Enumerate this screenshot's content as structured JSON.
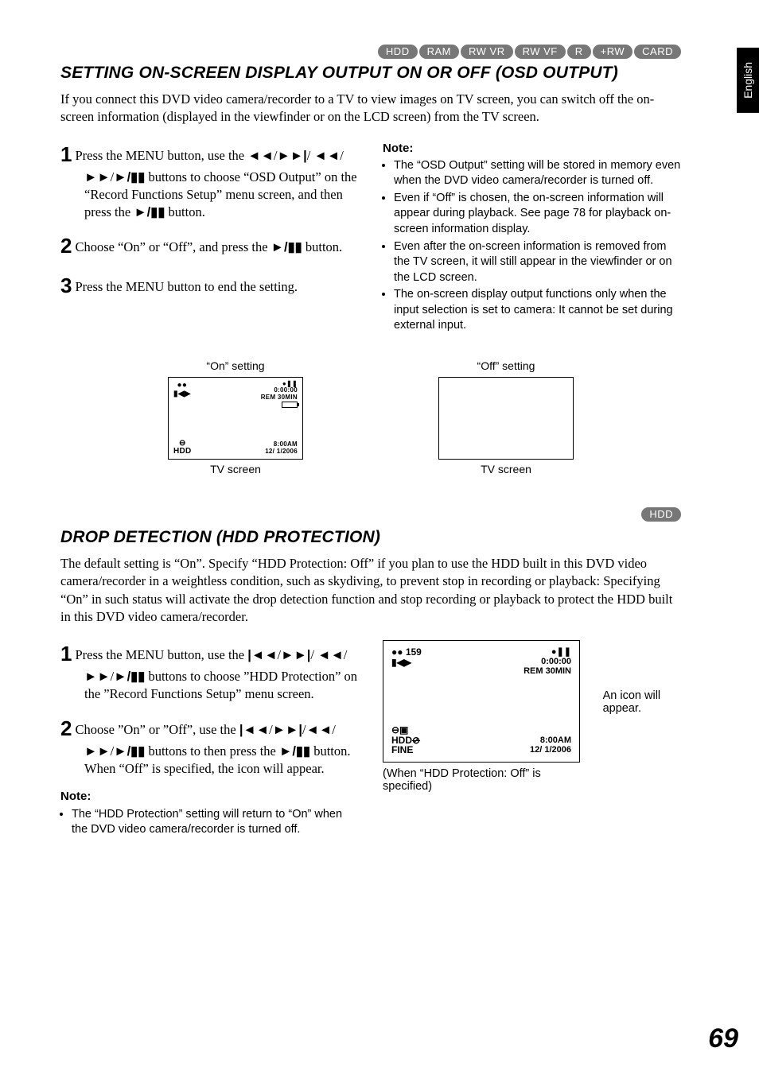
{
  "sideTab": "English",
  "pageNumber": "69",
  "tags1": [
    "HDD",
    "RAM",
    "RW VR",
    "RW VF",
    "R",
    "+RW",
    "CARD"
  ],
  "section1": {
    "title": "SETTING ON-SCREEN DISPLAY OUTPUT ON OR OFF (OSD OUTPUT)",
    "intro": "If you connect this DVD video camera/recorder to a TV to view images on TV screen, you can switch off the on-screen information (displayed in the viewfinder or on the LCD screen) from the TV screen.",
    "step1a": "Press the MENU button, use the ",
    "step1b": " buttons to choose “OSD Output” on the “Record Functions Setup” menu screen, and then press the ",
    "step1c": " button.",
    "step2a": "Choose “On” or “Off”, and press the ",
    "step2b": " button.",
    "step3": "Press the MENU button to end the setting.",
    "noteHead": "Note:",
    "notes": [
      "The “OSD Output” setting will be stored in memory even when the DVD video camera/recorder is turned off.",
      "Even if “Off” is chosen, the on-screen information will appear during playback. See page 78 for playback on-screen information display.",
      "Even after the on-screen information is removed from the TV screen, it will still appear in the viewfinder or on the LCD screen.",
      "The on-screen display output functions only when the input selection is set to camera: It cannot be set during external input."
    ],
    "tvOn": {
      "caption": "“On” setting",
      "below": "TV screen",
      "timecode": "0:00:00",
      "rem": "REM 30MIN",
      "time": "8:00AM",
      "date": "12/ 1/2006",
      "pause": "●❚❚"
    },
    "tvOff": {
      "caption": "“Off” setting",
      "below": "TV screen"
    }
  },
  "tags2": [
    "HDD"
  ],
  "section2": {
    "title": "DROP DETECTION (HDD PROTECTION)",
    "intro": "The default setting is “On”. Specify “HDD Protection: Off” if you plan to use the HDD built in this DVD video camera/recorder in a weightless condition, such as skydiving, to prevent stop in recording or playback: Specifying “On” in such status will activate the drop detection function and stop recording or playback to protect the HDD built in this DVD video camera/recorder.",
    "step1a": "Press the MENU button, use the ",
    "step1b": " buttons to choose ”HDD Protection” on the ”Record Functions Setup” menu screen.",
    "step2a": "Choose ”On” or ”Off”, use the ",
    "step2b": " buttons to then press the ",
    "step2c": " button.",
    "step2d": "When “Off” is specified, the icon will appear.",
    "noteHead": "Note:",
    "note1": "The “HDD Protection” setting will return to “On” when the DVD video camera/recorder is turned off.",
    "screen": {
      "counter": "●● 159",
      "timecode": "0:00:00",
      "rem": "REM 30MIN",
      "hdd": "HDD",
      "fine": "FINE",
      "time": "8:00AM",
      "date": "12/ 1/2006",
      "pause": "●❚❚",
      "caption": "(When “HDD Protection: Off” is specified)",
      "sideCaption": "An icon will appear."
    }
  }
}
